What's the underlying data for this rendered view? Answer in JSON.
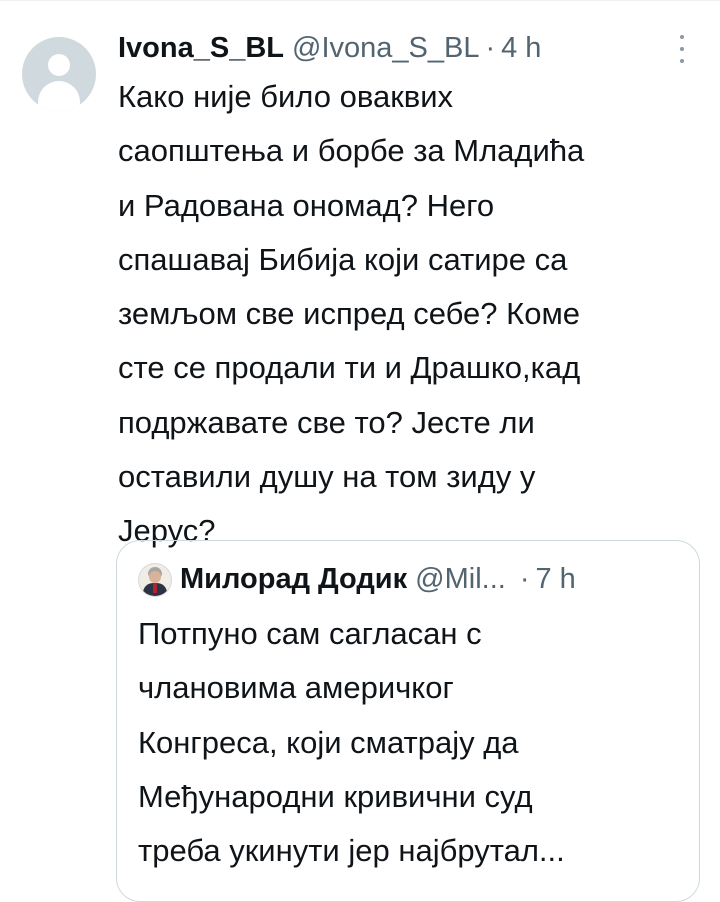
{
  "tweet": {
    "display_name": "Ivona_S_BL",
    "handle": "@Ivona_S_BL",
    "separator": "·",
    "time": "4 h",
    "text_lines": [
      "Како није било оваквих",
      "саопштења и борбе за Младића",
      "и Радована ономад? Него",
      "спашавај Бибија који сатире са",
      "земљом све испред себе? Коме",
      "сте се продали ти и Драшко,кад",
      "подржавате све то? Јесте ли",
      "оставили душу на том зиду у",
      "Јерус?"
    ]
  },
  "quoted_tweet": {
    "display_name": "Милорад Додик",
    "handle": "@Mil...",
    "separator": "·",
    "time": "7 h",
    "text_lines": [
      "Потпуно сам сагласан с",
      "члановима америчког",
      "Конгреса, који сматрају да",
      "Међународни кривични суд",
      "треба укинути јер најбрутал..."
    ]
  },
  "icons": {
    "avatar": "default-profile-icon",
    "more": "more-vertical-icon"
  },
  "colors": {
    "text_primary": "#0f1419",
    "text_secondary": "#536471",
    "border": "#cfd9de",
    "avatar_placeholder": "#cfd9de"
  }
}
